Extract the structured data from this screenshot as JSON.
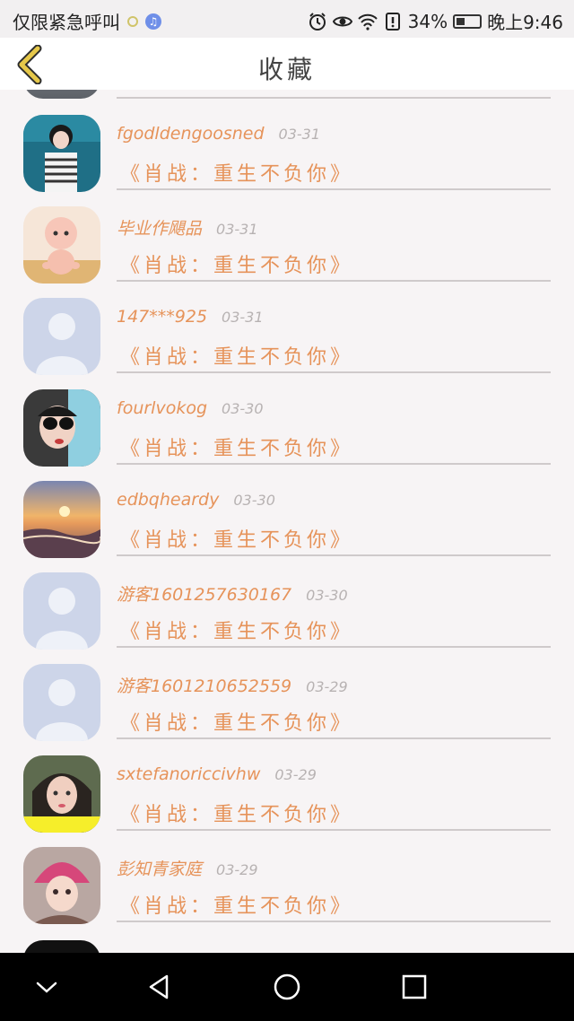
{
  "status_bar": {
    "carrier": "仅限紧急呼叫",
    "battery": "34%",
    "time": "晚上9:46"
  },
  "header": {
    "title": "收藏"
  },
  "items": [
    {
      "name": "fgodldengoosned",
      "date": "03-31",
      "work": "《肖战：重生不负你》"
    },
    {
      "name": "毕业作飓品",
      "date": "03-31",
      "work": "《肖战：重生不负你》"
    },
    {
      "name": "147***925",
      "date": "03-31",
      "work": "《肖战：重生不负你》"
    },
    {
      "name": "fourlvokog",
      "date": "03-30",
      "work": "《肖战：重生不负你》"
    },
    {
      "name": "edbqheardy",
      "date": "03-30",
      "work": "《肖战：重生不负你》"
    },
    {
      "name": "游客1601257630167",
      "date": "03-30",
      "work": "《肖战：重生不负你》"
    },
    {
      "name": "游客1601210652559",
      "date": "03-29",
      "work": "《肖战：重生不负你》"
    },
    {
      "name": "sxtefanoriccivhw",
      "date": "03-29",
      "work": "《肖战：重生不负你》"
    },
    {
      "name": "彭知青家庭",
      "date": "03-29",
      "work": "《肖战：重生不负你》"
    }
  ],
  "colors": {
    "accent": "#e6935a",
    "date": "#b7b2b2",
    "back_arrow": "#e6c84a"
  },
  "icons": [
    "back-arrow-icon",
    "alarm-icon",
    "eye-icon",
    "wifi-icon",
    "sim-icon",
    "battery-icon",
    "nav-collapse-icon",
    "nav-back-icon",
    "nav-home-icon",
    "nav-recents-icon"
  ]
}
